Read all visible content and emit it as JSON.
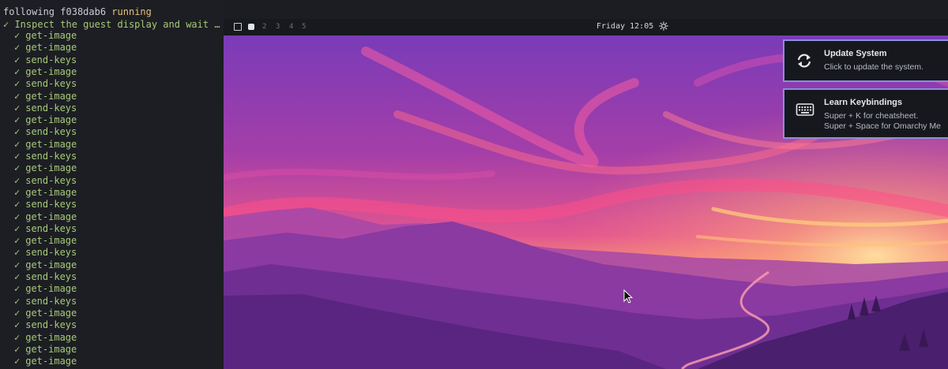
{
  "terminal": {
    "following_prefix": "following",
    "following_id": "f038dab6",
    "status": "running",
    "task": "✓ Inspect the guest display and wait f…",
    "check": "✓",
    "steps": [
      "get-image",
      "get-image",
      "send-keys",
      "get-image",
      "send-keys",
      "get-image",
      "send-keys",
      "get-image",
      "send-keys",
      "get-image",
      "send-keys",
      "get-image",
      "send-keys",
      "get-image",
      "send-keys",
      "get-image",
      "send-keys",
      "get-image",
      "send-keys",
      "get-image",
      "send-keys",
      "get-image",
      "send-keys",
      "get-image",
      "send-keys",
      "get-image",
      "get-image",
      "get-image"
    ]
  },
  "topbar": {
    "workspaces": [
      "2",
      "3",
      "4",
      "5"
    ],
    "clock": "Friday 12:05",
    "settings_icon": "sun-gear-icon"
  },
  "notifications": [
    {
      "icon": "refresh-icon",
      "title": "Update System",
      "body": [
        "Click to update the system."
      ]
    },
    {
      "icon": "keyboard-icon",
      "title": "Learn Keybindings",
      "body": [
        "Super + K for cheatsheet.",
        "Super + Space for Omarchy Me"
      ]
    }
  ],
  "colors": {
    "terminal_bg": "#1c1e23",
    "green": "#a8c97a",
    "running": "#e5c07b",
    "toast_border": "#8f8dd8"
  }
}
